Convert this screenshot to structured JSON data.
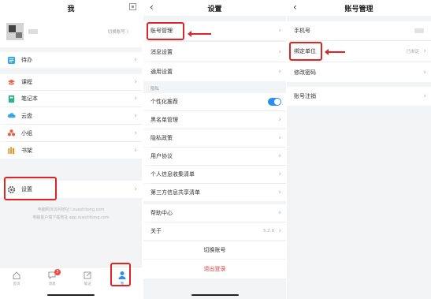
{
  "panel1": {
    "title": "我",
    "switch_account": "切换账号 〉",
    "menu": [
      {
        "label": "待办",
        "icon": "todo-icon",
        "color": "#3aa7e0"
      },
      {
        "label": "课程",
        "icon": "course-icon",
        "color": "#e8624a"
      },
      {
        "label": "笔记本",
        "icon": "notebook-icon",
        "color": "#2fb08a"
      },
      {
        "label": "云盘",
        "icon": "cloud-icon",
        "color": "#3aa7e0"
      },
      {
        "label": "小组",
        "icon": "group-icon",
        "color": "#e8624a"
      },
      {
        "label": "书架",
        "icon": "bookshelf-icon",
        "color": "#e8932a"
      }
    ],
    "settings_label": "设置",
    "footer_line1": "电脑网页访问地址 i.xueshitong.com",
    "footer_line2": "电脑客户端下载地址 app.xueshitong.com",
    "tabs": [
      {
        "label": "首页",
        "icon": "home-icon"
      },
      {
        "label": "消息",
        "icon": "message-icon",
        "badge": "3"
      },
      {
        "label": "笔记",
        "icon": "note-icon"
      },
      {
        "label": "我",
        "icon": "user-icon"
      }
    ]
  },
  "panel2": {
    "title": "设置",
    "group1": [
      "账号管理",
      "消息设置",
      "通用设置"
    ],
    "privacy_header": "隐私",
    "personalized": "个性化推荐",
    "group2": [
      "黑名单管理",
      "隐私政策",
      "用户协议",
      "个人信息收集清单",
      "第三方信息共享清单"
    ],
    "help": "帮助中心",
    "about": "关于",
    "about_version": "5.2.9",
    "switch_account": "切换账号",
    "logout": "退出登录"
  },
  "panel3": {
    "title": "账号管理",
    "phone": "手机号",
    "bind_unit": "绑定单位",
    "bind_status": "已绑定",
    "change_password": "修改密码",
    "deactivate": "账号注销"
  },
  "colors": {
    "accent": "#2b8df0",
    "highlight": "#e02424",
    "active_tab": "#2b8df0"
  }
}
